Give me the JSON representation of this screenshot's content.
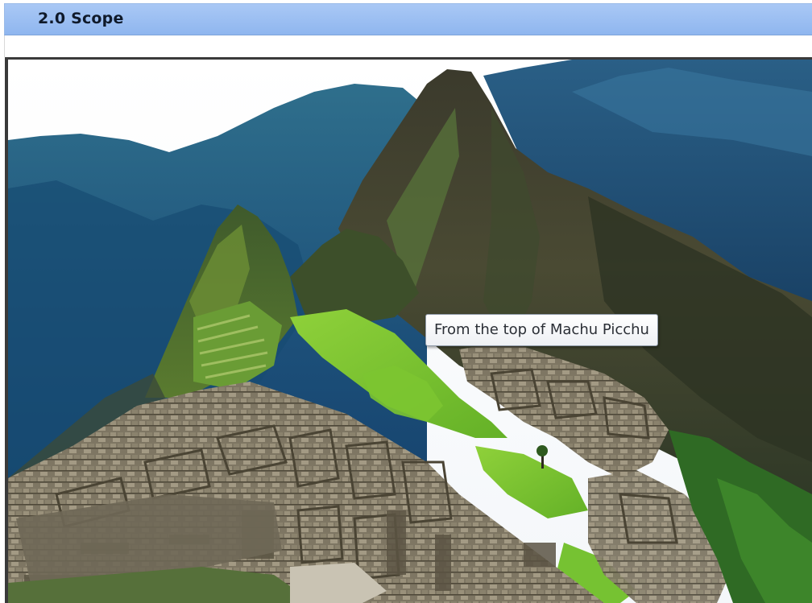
{
  "section": {
    "title": "2.0 Scope"
  },
  "image": {
    "subject": "mountain-ruins-photo",
    "tooltip": "From the top of Machu Picchu"
  },
  "colors": {
    "header_bg": "#8fb6ef",
    "frame_border": "#3a3a3a",
    "tooltip_border": "#8f9aa8"
  }
}
